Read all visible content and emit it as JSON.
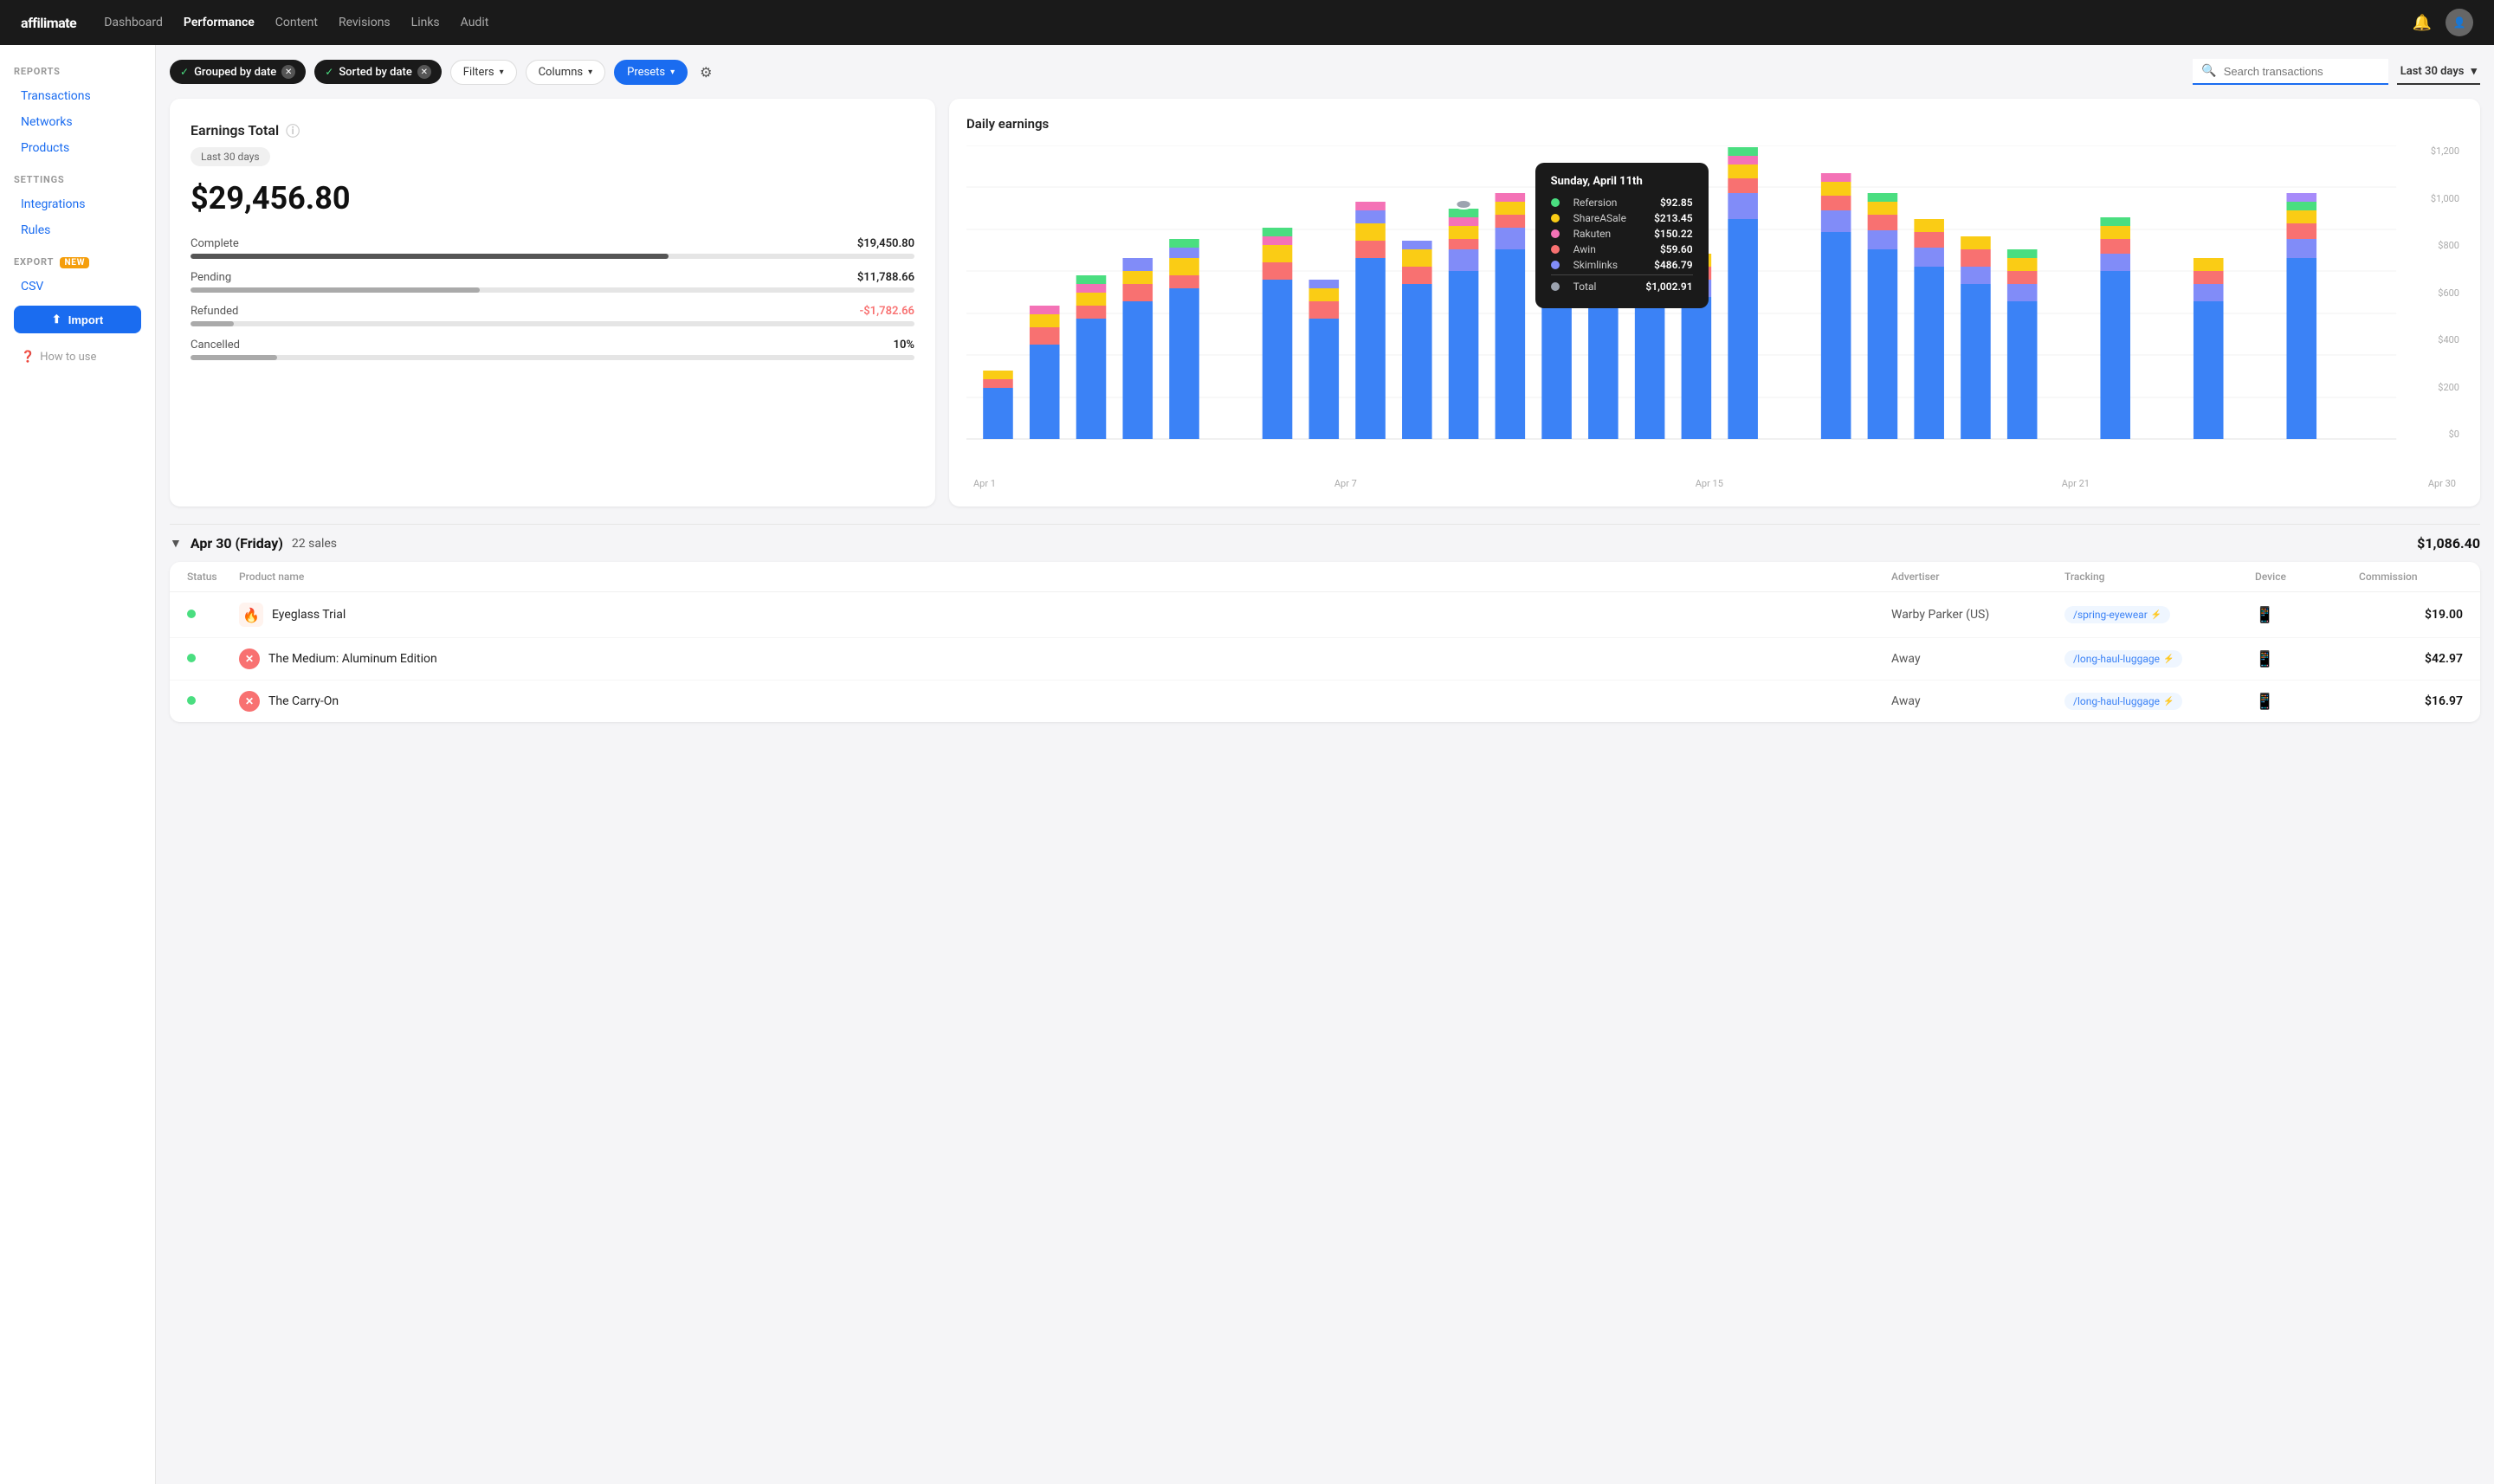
{
  "nav": {
    "logo": "affilimate",
    "links": [
      {
        "label": "Dashboard",
        "active": false
      },
      {
        "label": "Performance",
        "active": true
      },
      {
        "label": "Content",
        "active": false
      },
      {
        "label": "Revisions",
        "active": false
      },
      {
        "label": "Links",
        "active": false
      },
      {
        "label": "Audit",
        "active": false
      }
    ]
  },
  "sidebar": {
    "reports_title": "REPORTS",
    "reports_items": [
      {
        "label": "Transactions",
        "active": true
      },
      {
        "label": "Networks",
        "active": false
      },
      {
        "label": "Products",
        "active": false
      }
    ],
    "settings_title": "SETTINGS",
    "settings_items": [
      {
        "label": "Integrations",
        "active": false
      },
      {
        "label": "Rules",
        "active": false
      }
    ],
    "export_title": "EXPORT",
    "export_badge": "NEW",
    "export_items": [
      {
        "label": "CSV",
        "active": false
      }
    ],
    "import_label": "Import",
    "how_to_label": "How to use"
  },
  "filter_bar": {
    "chip1_label": "Grouped by date",
    "chip2_label": "Sorted by date",
    "filters_label": "Filters",
    "columns_label": "Columns",
    "presets_label": "Presets",
    "search_placeholder": "Search transactions",
    "date_range_label": "Last 30 days"
  },
  "earnings_card": {
    "title": "Earnings Total",
    "period": "Last 30 days",
    "total": "$29,456.80",
    "stats": [
      {
        "label": "Complete",
        "value": "$19,450.80",
        "progress": 66,
        "negative": false
      },
      {
        "label": "Pending",
        "value": "$11,788.66",
        "progress": 40,
        "negative": false
      },
      {
        "label": "Refunded",
        "value": "-$1,782.66",
        "progress": 6,
        "negative": true
      },
      {
        "label": "Cancelled",
        "value": "10%",
        "progress": 12,
        "negative": false
      }
    ]
  },
  "chart": {
    "title": "Daily earnings",
    "tooltip": {
      "date": "Sunday, April 11th",
      "rows": [
        {
          "label": "Refersion",
          "value": "$92.85",
          "color": "#4ade80"
        },
        {
          "label": "ShareASale",
          "value": "$213.45",
          "color": "#facc15"
        },
        {
          "label": "Rakuten",
          "value": "$150.22",
          "color": "#f472b6"
        },
        {
          "label": "Awin",
          "value": "$59.60",
          "color": "#f87171"
        },
        {
          "label": "Skimlinks",
          "value": "$486.79",
          "color": "#818cf8"
        },
        {
          "label": "Total",
          "value": "$1,002.91",
          "color": "#9ca3af"
        }
      ]
    },
    "x_labels": [
      "Apr 1",
      "Apr 7",
      "Apr 15",
      "Apr 21",
      "Apr 30"
    ],
    "y_labels": [
      "$1,200",
      "$1,000",
      "$800",
      "$600",
      "$400",
      "$200",
      "$0"
    ]
  },
  "transactions": {
    "group_date": "Apr 30 (Friday)",
    "group_sales": "22 sales",
    "group_total": "$1,086.40",
    "table_headers": [
      "Status",
      "Product name",
      "Advertiser",
      "Tracking",
      "Device",
      "Commission"
    ],
    "rows": [
      {
        "status": "complete",
        "product_name": "Eyeglass Trial",
        "product_icon": "🔥",
        "product_icon_bg": "#ff4500",
        "advertiser": "Warby Parker (US)",
        "tracking": "/spring-eyewear",
        "device": "mobile",
        "commission": "$19.00"
      },
      {
        "status": "complete",
        "product_name": "The Medium: Aluminum Edition",
        "product_icon": "✕",
        "product_icon_bg": "#f87171",
        "advertiser": "Away",
        "tracking": "/long-haul-luggage",
        "device": "mobile",
        "commission": "$42.97"
      },
      {
        "status": "complete",
        "product_name": "The Carry-On",
        "product_icon": "✕",
        "product_icon_bg": "#f87171",
        "advertiser": "Away",
        "tracking": "/long-haul-luggage",
        "device": "mobile",
        "commission": "$16.97"
      }
    ]
  }
}
